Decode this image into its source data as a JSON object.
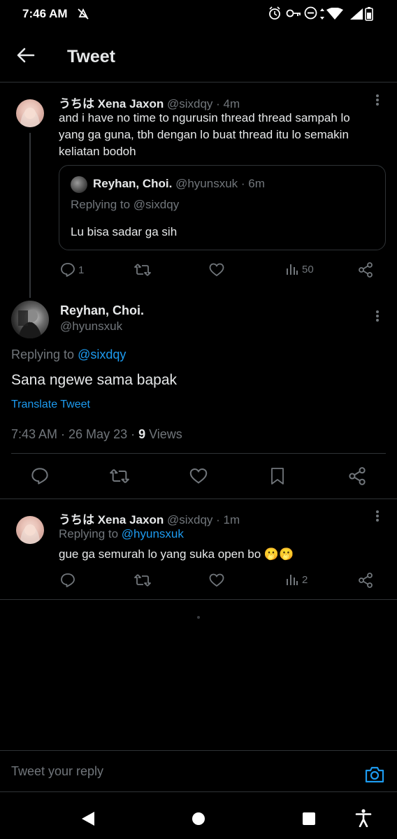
{
  "status_bar": {
    "time": "7:46 AM"
  },
  "header": {
    "title": "Tweet"
  },
  "quoted_tweet": {
    "display_name": "うちは Xena Jaxon",
    "handle": "@sixdqy",
    "time": "· 4m",
    "text_line1": "and i have no time to ngurusin thread thread sampah lo",
    "text_line2": "yang ga guna, tbh dengan lo buat thread itu lo semakin",
    "text_line3": "keliatan bodoh",
    "quote": {
      "display_name": "Reyhan, Choi.",
      "handle": "@hyunsxuk",
      "time": "· 6m",
      "replying_to": "Replying to @sixdqy",
      "text": "Lu bisa sadar ga sih"
    },
    "stats": {
      "replies": "1",
      "views": "50"
    }
  },
  "main_tweet": {
    "display_name": "Reyhan, Choi.",
    "handle": "@hyunsxuk",
    "replying_label": "Replying to",
    "replying_handle": "@sixdqy",
    "text": "Sana ngewe sama bapak",
    "translate": "Translate Tweet",
    "timestamp": "7:43 AM · 26 May 23 · ",
    "views_count": "9",
    "views_label": " Views"
  },
  "reply_tweet": {
    "display_name": "うちは Xena Jaxon",
    "handle": "@sixdqy",
    "time": "· 1m",
    "replying_label": "Replying to",
    "replying_handle": "@hyunsxuk",
    "text": "gue ga semurah lo yang suka open bo 🫢🫢",
    "stats": {
      "views": "2"
    }
  },
  "reply_bar": {
    "placeholder": "Tweet your reply"
  },
  "colors": {
    "accent": "#1d9bf0",
    "muted": "#71767b",
    "text": "#e7e9ea",
    "divider": "#2f3336",
    "background": "#000000"
  }
}
